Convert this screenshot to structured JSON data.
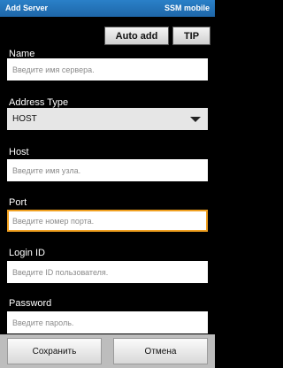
{
  "titlebar": {
    "title": "Add Server",
    "brand": "SSM mobile"
  },
  "toolbar": {
    "auto_add_label": "Auto add",
    "tip_label": "TIP"
  },
  "form": {
    "name": {
      "label": "Name",
      "placeholder": "Введите имя сервера."
    },
    "address_type": {
      "label": "Address Type",
      "value": "HOST"
    },
    "host": {
      "label": "Host",
      "placeholder": "Введите имя узла."
    },
    "port": {
      "label": "Port",
      "placeholder": "Введите номер порта."
    },
    "login_id": {
      "label": "Login ID",
      "placeholder": "Введите ID пользователя."
    },
    "password": {
      "label": "Password",
      "placeholder": "Введите пароль."
    }
  },
  "actions": {
    "save_label": "Сохранить",
    "cancel_label": "Отмена"
  },
  "colors": {
    "titlebar": "#1e66a8",
    "focus_border": "#f0a020",
    "background": "#000000"
  },
  "icons": {
    "dropdown": "chevron-down-icon"
  }
}
